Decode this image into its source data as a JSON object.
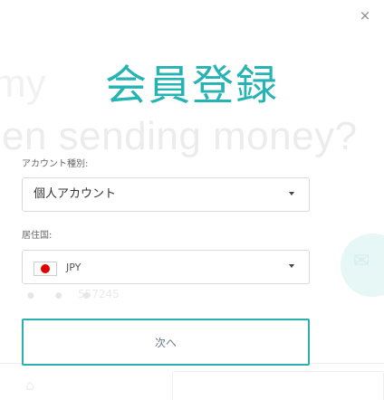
{
  "background": {
    "headline_top": "my",
    "headline": "en sending money?",
    "amount": "557245",
    "dots": "● ● ●"
  },
  "modal": {
    "close_label": "×",
    "title": "会員登録",
    "account_type": {
      "label": "アカウント種別:",
      "value": "個人アカウント"
    },
    "residence": {
      "label": "居住国:",
      "currency": "JPY"
    },
    "next_label": "次へ"
  },
  "colors": {
    "accent": "#2bb0b0",
    "title": "#25b3b3",
    "flag_red": "#e00000"
  },
  "icons": {
    "close": "close-icon",
    "dropdown": "chevron-down-icon",
    "flag": "japan-flag-icon"
  }
}
